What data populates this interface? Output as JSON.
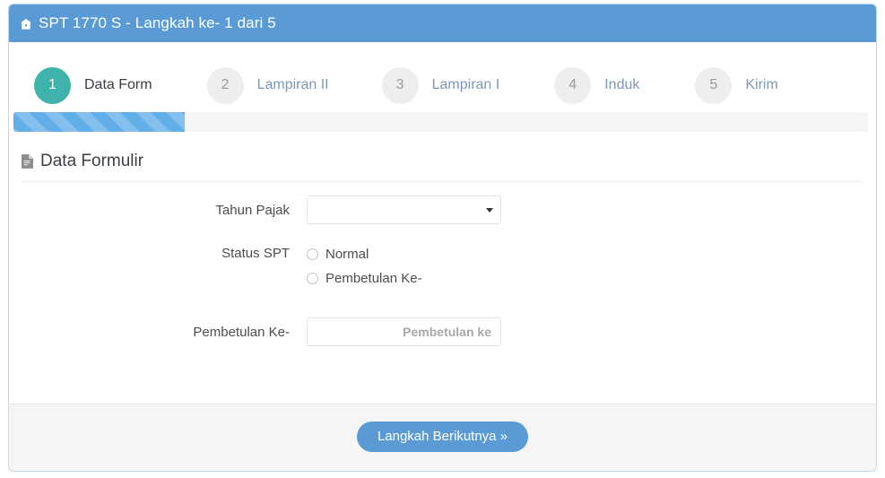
{
  "header": {
    "icon": "home-icon",
    "title": "SPT 1770 S - Langkah ke- 1 dari 5"
  },
  "stepper": {
    "steps": [
      {
        "number": "1",
        "label": "Data Form",
        "active": true
      },
      {
        "number": "2",
        "label": "Lampiran II",
        "active": false
      },
      {
        "number": "3",
        "label": "Lampiran I",
        "active": false
      },
      {
        "number": "4",
        "label": "Induk",
        "active": false
      },
      {
        "number": "5",
        "label": "Kirim",
        "active": false
      }
    ]
  },
  "progress": {
    "percent": 20,
    "percent_css": "20%"
  },
  "section": {
    "icon": "file-text-icon",
    "title": "Data Formulir"
  },
  "form": {
    "tahun_pajak": {
      "label": "Tahun Pajak",
      "value": "",
      "caret": "chevron-down-icon"
    },
    "status_spt": {
      "label": "Status SPT",
      "options": [
        {
          "label": "Normal",
          "checked": false
        },
        {
          "label": "Pembetulan Ke-",
          "checked": false
        }
      ]
    },
    "pembetulan_ke": {
      "label": "Pembetulan Ke-",
      "value": "",
      "placeholder": "Pembetulan ke"
    }
  },
  "footer": {
    "next_label": "Langkah Berikutnya »"
  },
  "colors": {
    "header_blue": "#5b9bd5",
    "active_step_teal": "#3fb3ab",
    "inactive_step_gray": "#eeeeee",
    "progress_blue": "#62aee8",
    "step_label_blue": "#7f97b6",
    "footer_gray": "#f5f5f5",
    "panel_border": "#bcd9ee"
  }
}
